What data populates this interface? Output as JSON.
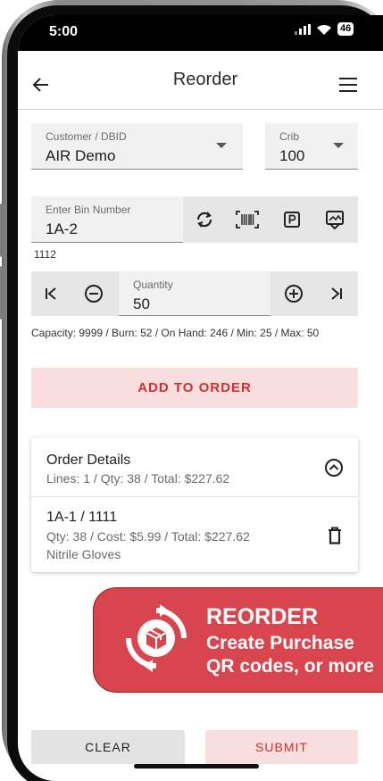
{
  "status": {
    "time": "5:00",
    "battery": "46"
  },
  "appbar": {
    "title": "Reorder",
    "back_icon": "arrow-left-icon",
    "menu_icon": "hamburger-menu-icon"
  },
  "customer": {
    "label": "Customer / DBID",
    "value": "AIR Demo"
  },
  "crib": {
    "label": "Crib",
    "value": "100"
  },
  "bin": {
    "label": "Enter Bin Number",
    "value": "1A-2",
    "sub_value": "1112"
  },
  "bin_tools": [
    "refresh-icon",
    "barcode-scan-icon",
    "p-box-icon",
    "image-check-icon"
  ],
  "quantity": {
    "label": "Quantity",
    "value": "50"
  },
  "stats": "Capacity: 9999 / Burn: 52 / On Hand: 246 / Min: 25 / Max: 50",
  "add_button": "ADD TO ORDER",
  "order": {
    "title": "Order Details",
    "summary": "Lines: 1 / Qty: 38 / Total: $227.62",
    "line": {
      "bin": "1A-1 / 1111",
      "detail": "Qty: 38 / Cost: $5.99 / Total: $227.62",
      "name": "Nitrile Gloves"
    }
  },
  "promo": {
    "title": "REORDER",
    "line1": "Create Purchase",
    "line2": "QR codes, or more"
  },
  "footer": {
    "clear": "CLEAR",
    "submit": "SUBMIT"
  },
  "colors": {
    "accent": "#d32f2f",
    "accent_light": "#f8dede",
    "promo": "#d9454e",
    "field_bg": "#f1f1f1"
  }
}
